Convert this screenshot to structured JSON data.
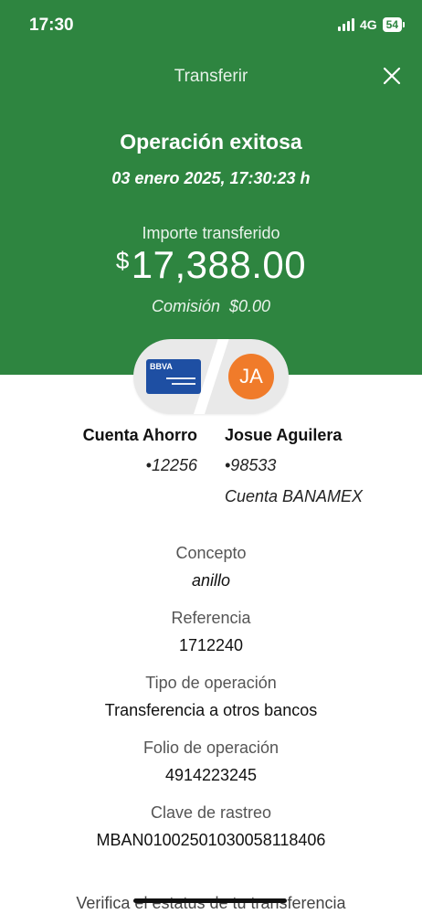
{
  "status_bar": {
    "time": "17:30",
    "network": "4G",
    "battery": "54"
  },
  "header": {
    "title": "Transferir",
    "close_icon": "close-icon"
  },
  "result": {
    "headline": "Operación exitosa",
    "datetime": "03 enero 2025, 17:30:23 h",
    "amount_label": "Importe transferido",
    "currency_symbol": "$",
    "amount": "17,388.00",
    "commission": "Comisión  $0.00"
  },
  "transfer_icons": {
    "card_brand": "BBVA",
    "avatar_initials": "JA"
  },
  "from_account": {
    "name": "Cuenta Ahorro",
    "number": "•12256"
  },
  "to_account": {
    "name": "Josue Aguilera",
    "number": "•98533",
    "bank": "Cuenta BANAMEX"
  },
  "details": [
    {
      "label": "Concepto",
      "value": "anillo"
    },
    {
      "label": "Referencia",
      "value": "1712240"
    },
    {
      "label": "Tipo de operación",
      "value": "Transferencia a otros bancos"
    },
    {
      "label": "Folio de operación",
      "value": "4914223245"
    },
    {
      "label": "Clave de rastreo",
      "value": "MBAN01002501030058118406"
    }
  ],
  "footer": {
    "verify_link": "Verifica el estatus de tu transferencia"
  },
  "colors": {
    "brand_green": "#2e8540",
    "avatar_orange": "#f07b2a",
    "card_blue": "#1e4fa3"
  }
}
